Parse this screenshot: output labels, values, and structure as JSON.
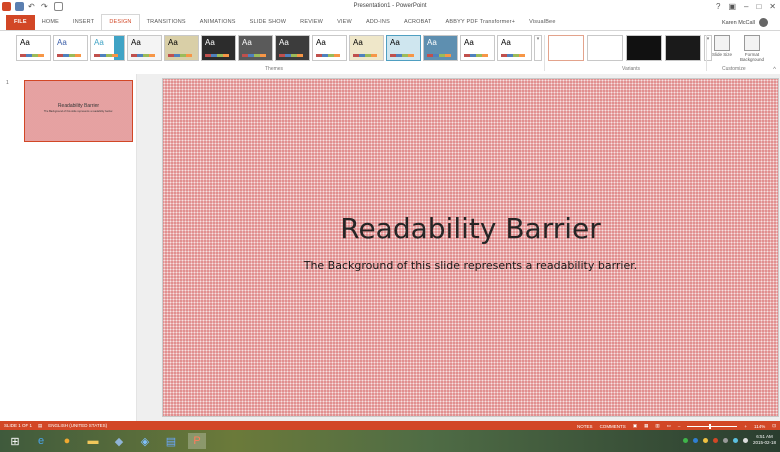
{
  "app": {
    "title": "Presentation1 - PowerPoint",
    "user": "Karen McCall"
  },
  "qat": {
    "icons": [
      "powerpoint-icon",
      "save-icon",
      "undo-icon",
      "redo-icon",
      "start-from-beginning-icon"
    ]
  },
  "tabs": [
    "FILE",
    "HOME",
    "INSERT",
    "DESIGN",
    "TRANSITIONS",
    "ANIMATIONS",
    "SLIDE SHOW",
    "REVIEW",
    "VIEW",
    "ADD-INS",
    "ACROBAT",
    "ABBYY PDF Transformer+",
    "VisualBee"
  ],
  "active_tab": "DESIGN",
  "ribbon": {
    "themes_label": "Themes",
    "variants_label": "Variants",
    "customize_label": "Customize",
    "theme_sample": "Aa",
    "slide_size": "Slide Size",
    "format_background": "Format Background"
  },
  "colors": {
    "accent": "#d24726",
    "slide_bg": "#e08b8b"
  },
  "slide_pane": {
    "number": "1",
    "thumb_title": "Readability Barrier",
    "thumb_sub": "The Background of this slide represents a readability barrier."
  },
  "slide": {
    "title": "Readability Barrier",
    "subtitle": "The Background of this slide represents a readability barrier."
  },
  "status": {
    "slide_of": "SLIDE 1 OF 1",
    "language": "ENGLISH (UNITED STATES)",
    "notes": "NOTES",
    "comments": "COMMENTS",
    "zoom": "114%"
  },
  "taskbar": {
    "time": "6:51 AM",
    "date": "2015-02-18"
  }
}
